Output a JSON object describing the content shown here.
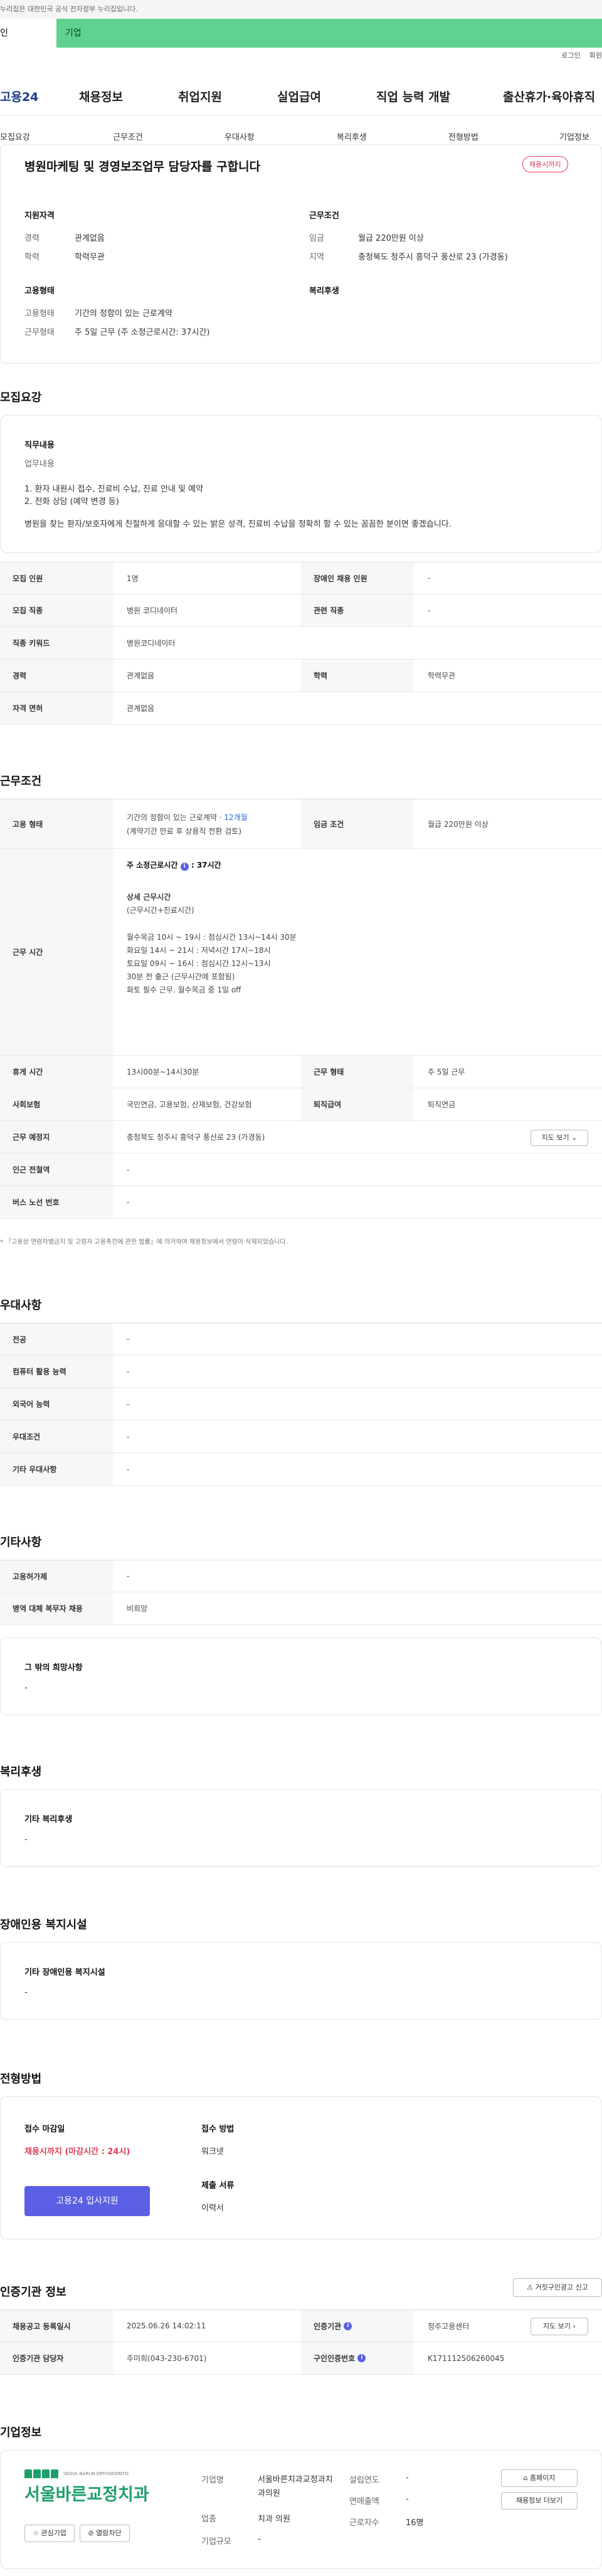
{
  "gov_banner": "누리집은 대한민국 공식 전자정부 누리집입니다.",
  "top_tabs": [
    "인",
    "기업"
  ],
  "top_links": [
    "로그인",
    "회원"
  ],
  "logo": "고용24",
  "gnb": [
    "채용정보",
    "취업지원",
    "실업급여",
    "직업 능력 개발",
    "출산휴가·육아휴직"
  ],
  "lnb": [
    "모집요강",
    "근무조건",
    "우대사항",
    "복리후생",
    "전형방법",
    "기업정보"
  ],
  "header": {
    "title": "병원마케팅 및 경영보조업무 담당자를 구합니다",
    "badge": "채용시까지",
    "qual_title": "지원자격",
    "cond_title": "근무조건",
    "emp_title": "고용형태",
    "welfare_title": "복리후생",
    "qual": [
      {
        "k": "경력",
        "v": "관계없음"
      },
      {
        "k": "학력",
        "v": "학력무관"
      }
    ],
    "cond": [
      {
        "k": "임금",
        "v": "월급 220만원 이상"
      },
      {
        "k": "지역",
        "v": "충청북도 청주시 흥덕구 풍산로 23 (가경동)"
      }
    ],
    "emp": [
      {
        "k": "고용형태",
        "v": "기간의 정함이 있는 근로계약"
      },
      {
        "k": "근무형태",
        "v": "주 5일 근무 (주 소정근로시간: 37시간)"
      }
    ]
  },
  "recruit": {
    "title": "모집요강",
    "job_label": "직무내용",
    "job_sub": "업무내용",
    "lines": [
      "1. 환자 내원시 접수, 진료비 수납, 진료 안내 및 예약",
      "2. 전화 상담 (예약 변경 등)"
    ],
    "desc": "병원을 찾는 환자/보호자에게 친절하게 응대할 수 있는 밝은 성격, 진료비 수납을 정확히 할 수 있는 꼼꼼한 분이면 좋겠습니다.",
    "rows": [
      {
        "k1": "모집 인원",
        "v1": "1명",
        "k2": "장애인 채용 인원",
        "v2": "-"
      },
      {
        "k1": "모집 직종",
        "v1": "병원 코디네이터",
        "k2": "관련 직종",
        "v2": "-"
      },
      {
        "k1": "직종 키워드",
        "v1": "병원코디네이터"
      },
      {
        "k1": "경력",
        "v1": "관계없음",
        "k2": "학력",
        "v2": "학력무관"
      },
      {
        "k1": "자격 면허",
        "v1": "관계없음"
      }
    ]
  },
  "work": {
    "title": "근무조건",
    "emp_k": "고용 형태",
    "emp_v": "기간의 정함이 있는 근로계약 · ",
    "emp_months": "12개월",
    "emp_v2": "(계약기간 만료 후 상용직 전환 검토)",
    "wage_k": "임금 조건",
    "wage_v": "월급 220만원 이상",
    "hours_k": "근무 시간",
    "hours_title": "주 소정근로시간",
    "hours_val": ": 37시간",
    "detail_title": "상세 근무시간",
    "detail_sub": "(근무시간+진료시간)",
    "hours_lines": [
      "월수목금  10시 ~ 19시  : 점심시간 13시~14시 30분",
      "화요일  14시 ~ 21시 : 저녁시간 17시~18시",
      "토요일  09시 ~ 16시 : 점심시간 12시~13시",
      "30분 전 출근 (근무시간에 포함됨)",
      "화토 필수 근무. 월수목금 중 1일 off"
    ],
    "rows": [
      {
        "k1": "휴게 시간",
        "v1": "13시00분~14시30분",
        "k2": "근무 형태",
        "v2": "주 5일 근무"
      },
      {
        "k1": "사회보험",
        "v1": "국민연금, 고용보험, 산재보험, 건강보험",
        "k2": "퇴직급여",
        "v2": "퇴직연금"
      }
    ],
    "place_k": "근무 예정지",
    "place_v": "충청북도 청주시 흥덕구 풍산로 23 (가경동)",
    "map_btn": "지도 보기",
    "station_k": "인근 전철역",
    "station_v": "-",
    "bus_k": "버스 노선 번호",
    "bus_v": "-",
    "note": "『고용상 연령차별금지 및 고령자 고용촉진에 관한 법률』에 의거하여 채용정보에서 연령이 삭제되었습니다."
  },
  "pref": {
    "title": "우대사항",
    "rows": [
      {
        "k": "전공",
        "v": "-"
      },
      {
        "k": "컴퓨터 활용 능력",
        "v": "-"
      },
      {
        "k": "외국어 능력",
        "v": "-"
      },
      {
        "k": "우대조건",
        "v": "-"
      },
      {
        "k": "기타 우대사항",
        "v": "-"
      }
    ]
  },
  "other": {
    "title": "기타사항",
    "rows": [
      {
        "k": "고용허가제",
        "v": "-"
      },
      {
        "k": "병역 대체 복무자 채용",
        "v": "비희망"
      }
    ],
    "hope_title": "그 밖의 희망사항",
    "hope_v": "-"
  },
  "welfare": {
    "title": "복리후생",
    "box_title": "기타 복리후생",
    "box_v": "-"
  },
  "disab": {
    "title": "장애인용 복지시설",
    "box_title": "기타 장애인용 복지시설",
    "box_v": "-"
  },
  "selection": {
    "title": "전형방법",
    "deadline_k": "접수 마감일",
    "deadline_v": "채용시까지 (마감시간 : 24시)",
    "method_k": "접수 방법",
    "method_v": "워크넷",
    "docs_k": "제출 서류",
    "docs_v": "이력서",
    "apply_btn": "고용24 입사지원"
  },
  "agency": {
    "title": "인증기관 정보",
    "report_btn": "거짓구인광고 신고",
    "rows": [
      {
        "k1": "채용공고 등록일시",
        "v1": "2025.06.26 14:02:11",
        "k2": "인증기관",
        "v2": "청주고용센터"
      },
      {
        "k1": "인증기관 담당자",
        "v1": "주미희(043-230-6701)",
        "k2": "구인인증번호",
        "v2": "K171112506260045"
      }
    ],
    "map_btn": "지도 보기"
  },
  "company": {
    "title": "기업정보",
    "logo_text": "서울바른교정치과",
    "logo_sub": "SEOUL BARUN ORTHODONTIC",
    "interest_btn": "관심기업",
    "block_btn": "열람차단",
    "f": [
      {
        "k": "기업명",
        "v": "서울바른치과교정과치과의원"
      },
      {
        "k": "업종",
        "v": "치과 의원"
      },
      {
        "k": "기업규모",
        "v": "-"
      }
    ],
    "g": [
      {
        "k": "설립연도",
        "v": "-"
      },
      {
        "k": "연매출액",
        "v": "-"
      },
      {
        "k": "근로자수",
        "v": "16명"
      }
    ],
    "home_btn": "홈페이지",
    "info_btn": "채용정보 더보기"
  },
  "colors": {
    "accent": "#5b5fe3",
    "top_green": "#5fd28f",
    "red": "#e03b57",
    "blue": "#2a6bdc"
  }
}
